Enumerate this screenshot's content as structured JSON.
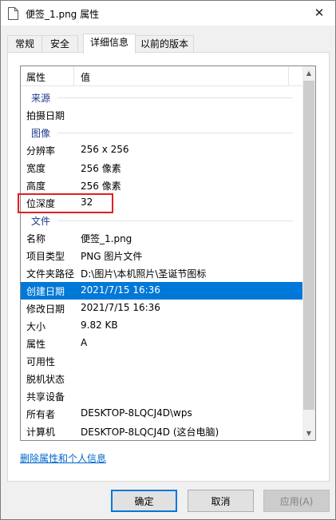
{
  "window": {
    "title": "便签_1.png 属性",
    "close_glyph": "✕"
  },
  "tabs": [
    {
      "label": "常规"
    },
    {
      "label": "安全"
    },
    {
      "label": "详细信息"
    },
    {
      "label": "以前的版本"
    }
  ],
  "columns": {
    "property": "属性",
    "value": "值"
  },
  "rows": [
    {
      "group": "来源"
    },
    {
      "key": "拍摄日期",
      "value": ""
    },
    {
      "group": "图像"
    },
    {
      "key": "分辨率",
      "value": "256 x 256"
    },
    {
      "key": "宽度",
      "value": "256 像素"
    },
    {
      "key": "高度",
      "value": "256 像素"
    },
    {
      "key": "位深度",
      "value": "32"
    },
    {
      "group": "文件"
    },
    {
      "key": "名称",
      "value": "便签_1.png"
    },
    {
      "key": "项目类型",
      "value": "PNG 图片文件"
    },
    {
      "key": "文件夹路径",
      "value": "D:\\图片\\本机照片\\圣诞节图标"
    },
    {
      "key": "创建日期",
      "value": "2021/7/15 16:36",
      "selected": true
    },
    {
      "key": "修改日期",
      "value": "2021/7/15 16:36"
    },
    {
      "key": "大小",
      "value": "9.82 KB"
    },
    {
      "key": "属性",
      "value": "A"
    },
    {
      "key": "可用性",
      "value": ""
    },
    {
      "key": "脱机状态",
      "value": ""
    },
    {
      "key": "共享设备",
      "value": ""
    },
    {
      "key": "所有者",
      "value": "DESKTOP-8LQCJ4D\\wps"
    },
    {
      "key": "计算机",
      "value": "DESKTOP-8LQCJ4D (这台电脑)"
    }
  ],
  "link": {
    "label": "删除属性和个人信息"
  },
  "buttons": {
    "ok": "确定",
    "cancel": "取消",
    "apply": "应用(A)"
  },
  "icons": {
    "file": "file-icon",
    "scroll_up": "scroll-up-arrow-icon",
    "scroll_down": "scroll-down-arrow-icon"
  },
  "colors": {
    "selection": "#0078d7",
    "group_text": "#1e3b8c",
    "link": "#0066cc",
    "highlight_box": "#e02020"
  }
}
